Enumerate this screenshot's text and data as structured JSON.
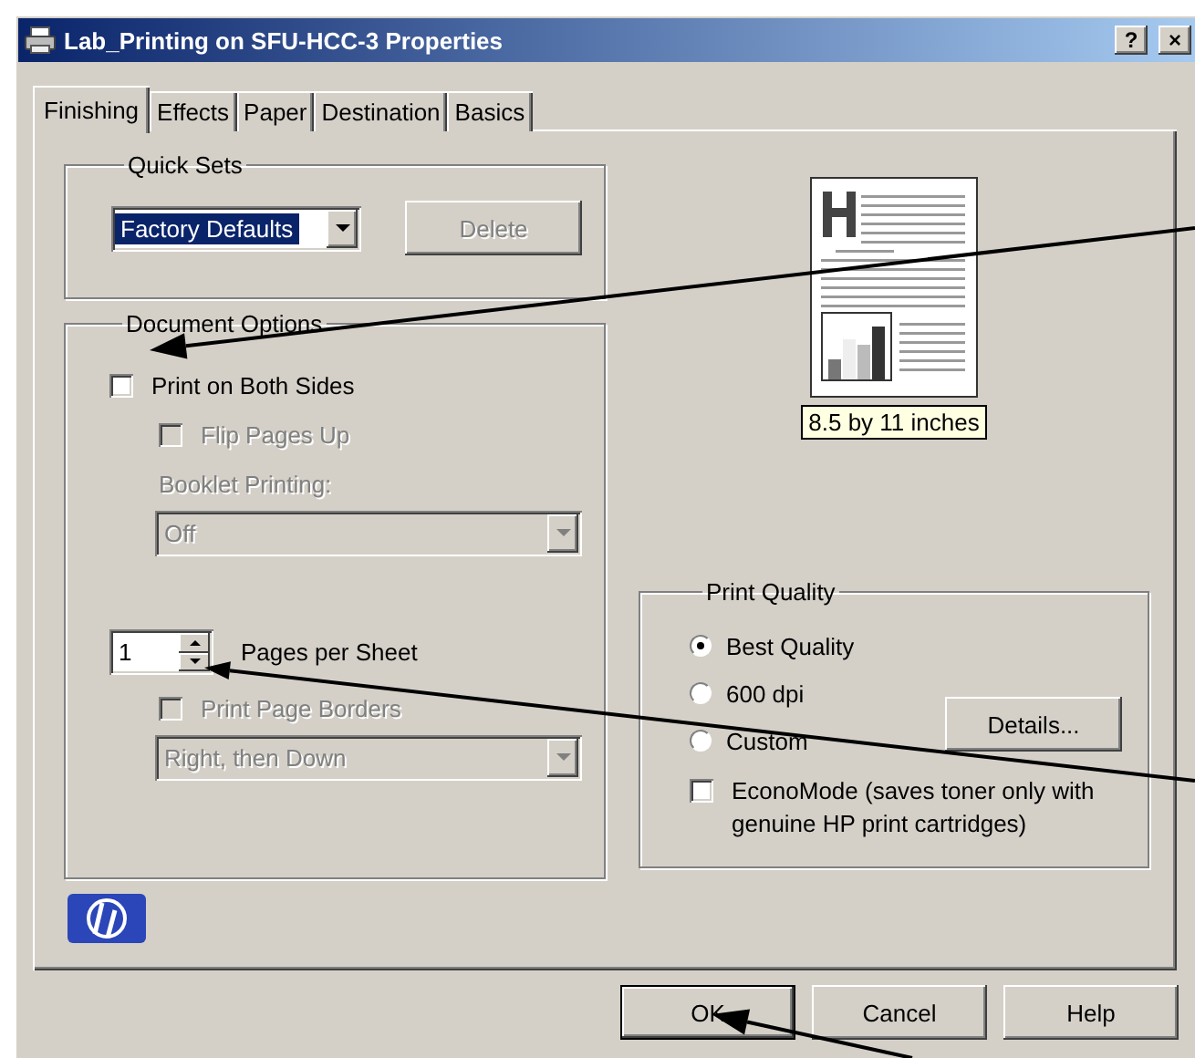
{
  "window": {
    "title": "Lab_Printing on SFU-HCC-3 Properties",
    "help_button": "?",
    "close_button": "×"
  },
  "tabs": [
    {
      "label": "Finishing",
      "selected": true
    },
    {
      "label": "Effects",
      "selected": false
    },
    {
      "label": "Paper",
      "selected": false
    },
    {
      "label": "Destination",
      "selected": false
    },
    {
      "label": "Basics",
      "selected": false
    }
  ],
  "quick_sets": {
    "label": "Quick Sets",
    "value": "Factory Defaults",
    "delete_button": {
      "label": "Delete",
      "disabled": true
    }
  },
  "document_options": {
    "label": "Document Options",
    "items": [
      {
        "kind": "checkbox",
        "label": "Print on Both Sides",
        "checked": false,
        "disabled": false,
        "children": [
          {
            "kind": "checkbox",
            "label": "Flip Pages Up",
            "checked": false,
            "disabled": true
          },
          {
            "kind": "label",
            "label": "Booklet Printing:",
            "disabled": true
          },
          {
            "kind": "dropdown",
            "value": "Off",
            "disabled": true
          }
        ]
      },
      {
        "kind": "spinner",
        "value": "1",
        "label": "Pages per Sheet",
        "disabled": false,
        "children": [
          {
            "kind": "checkbox",
            "label": "Print Page Borders",
            "checked": false,
            "disabled": true
          },
          {
            "kind": "dropdown",
            "value": "Right, then Down",
            "disabled": true
          }
        ]
      }
    ]
  },
  "preview": {
    "caption": "8.5 by 11 inches"
  },
  "print_quality": {
    "label": "Print Quality",
    "options": [
      {
        "label": "Best Quality",
        "selected": true
      },
      {
        "label": "600 dpi",
        "selected": false
      },
      {
        "label": "Custom",
        "selected": false
      }
    ],
    "details_button": "Details...",
    "economode": {
      "label": "EconoMode (saves toner only with genuine HP print cartridges)",
      "checked": false
    }
  },
  "buttons": [
    {
      "label": "OK",
      "default": true
    },
    {
      "label": "Cancel",
      "default": false
    },
    {
      "label": "Help",
      "default": false
    }
  ]
}
